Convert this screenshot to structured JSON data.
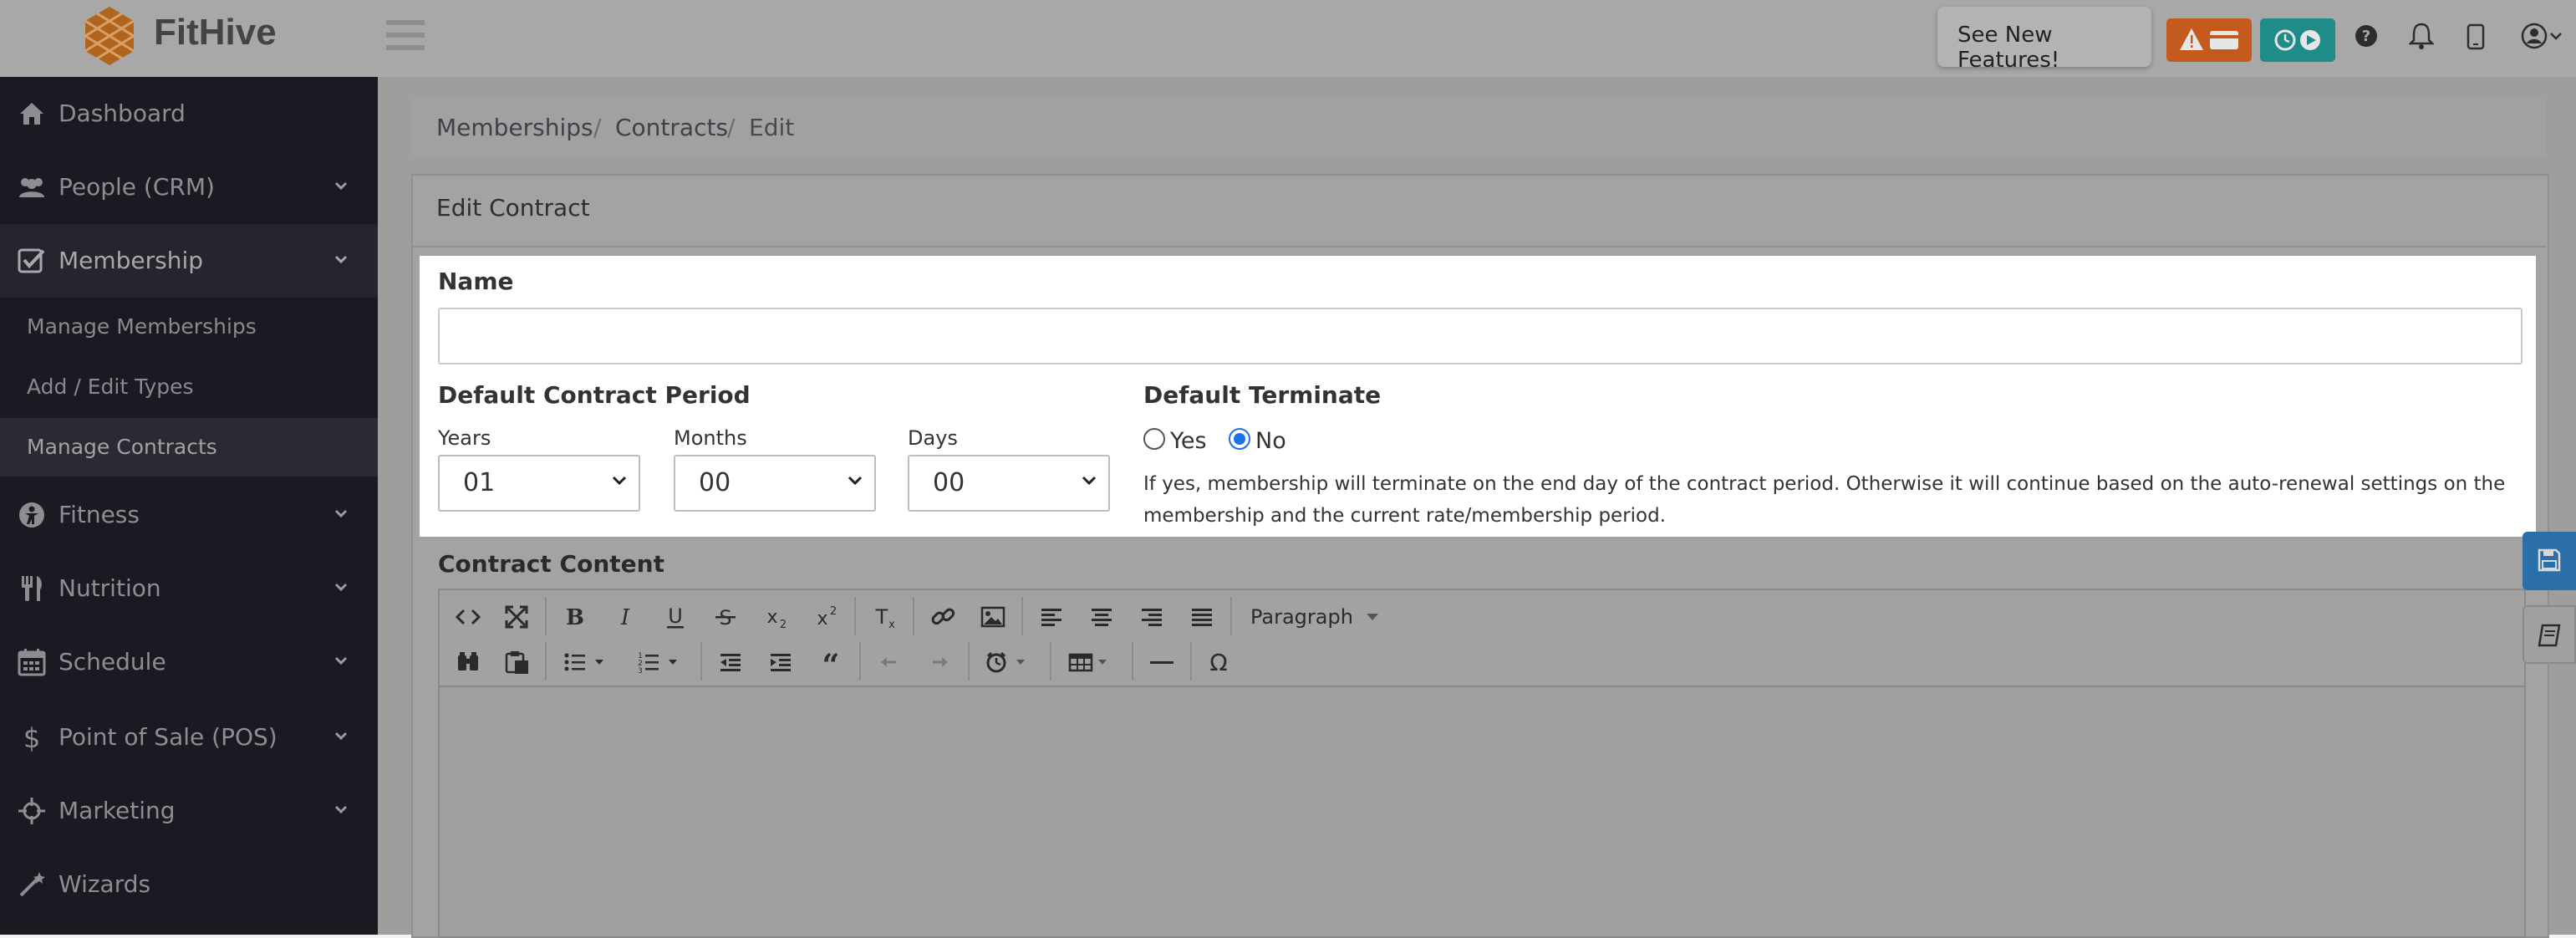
{
  "brand": {
    "name": "FitHive"
  },
  "header": {
    "new_features_label": "See New Features!"
  },
  "sidebar": {
    "items": [
      {
        "label": "Dashboard",
        "icon": "home-icon"
      },
      {
        "label": "People (CRM)",
        "icon": "users-icon"
      },
      {
        "label": "Membership",
        "icon": "check-square-icon"
      },
      {
        "label": "Fitness",
        "icon": "fitness-icon"
      },
      {
        "label": "Nutrition",
        "icon": "utensils-icon"
      },
      {
        "label": "Schedule",
        "icon": "calendar-icon"
      },
      {
        "label": "Point of Sale (POS)",
        "icon": "dollar-icon"
      },
      {
        "label": "Marketing",
        "icon": "crosshair-icon"
      },
      {
        "label": "Wizards",
        "icon": "magic-wand-icon"
      }
    ],
    "membership_sub": [
      "Manage Memberships",
      "Add / Edit Types",
      "Manage Contracts"
    ]
  },
  "breadcrumb": [
    "Memberships",
    "Contracts",
    "Edit"
  ],
  "breadcrumb_sep": "/",
  "panel": {
    "title": "Edit Contract"
  },
  "form": {
    "name_label": "Name",
    "name_value": "",
    "period_label": "Default Contract Period",
    "years_label": "Years",
    "years_value": "01",
    "months_label": "Months",
    "months_value": "00",
    "days_label": "Days",
    "days_value": "00",
    "terminate_label": "Default Terminate",
    "yes_label": "Yes",
    "no_label": "No",
    "terminate_selected": "No",
    "terminate_help_1": "If yes, membership will terminate on the end day of the contract period. Otherwise it will continue based on the auto-renewal settings on the",
    "terminate_help_2": "membership and the current rate/membership period.",
    "content_label": "Contract Content"
  },
  "editor": {
    "paragraph_label": "Paragraph"
  },
  "colors": {
    "sidebar_bg": "#1a1a22",
    "alert_button": "#c55a1f",
    "timer_button": "#1f8c8a",
    "side_tab": "#2a6fa8"
  }
}
